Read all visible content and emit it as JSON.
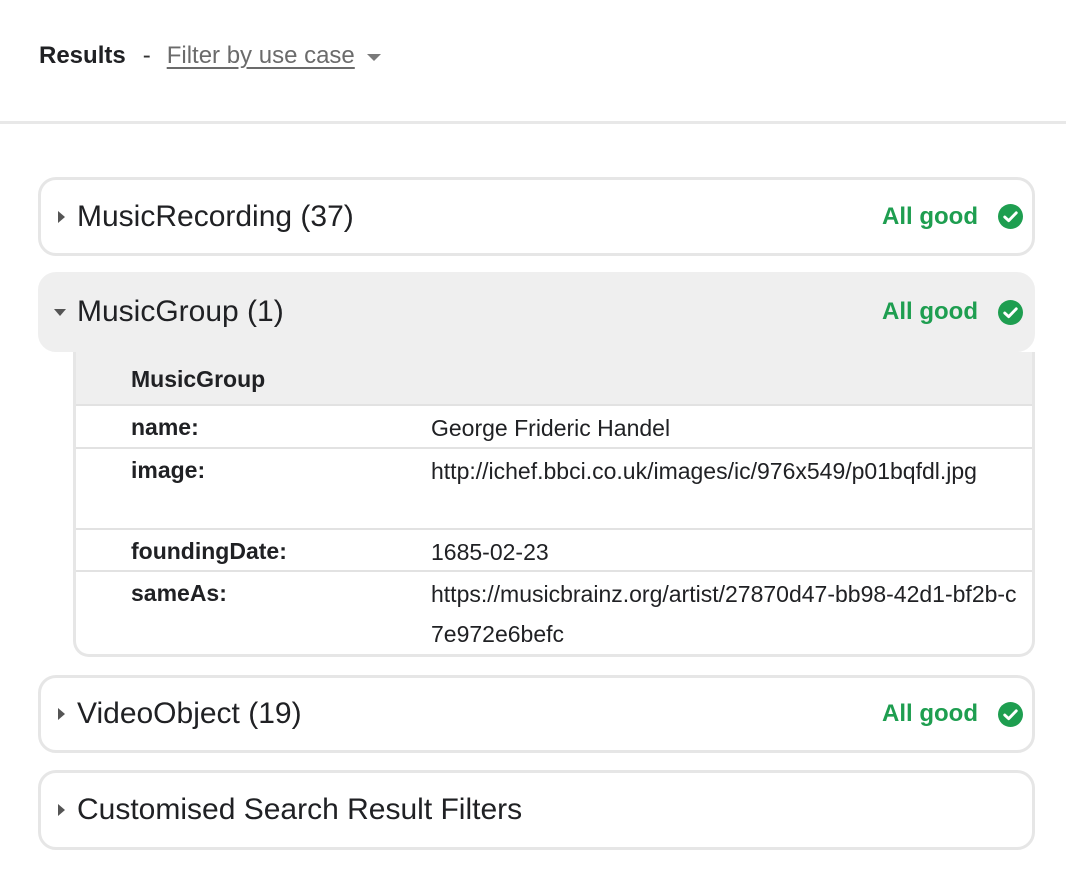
{
  "header": {
    "title": "Results",
    "separator": "-",
    "filter_label": "Filter by use case"
  },
  "status_color": "#1e9e50",
  "sections": [
    {
      "title": "MusicRecording (37)",
      "status": "All good",
      "icon": "check-circle-icon",
      "expanded": false
    },
    {
      "title": "MusicGroup (1)",
      "status": "All good",
      "icon": "check-circle-icon",
      "expanded": true
    },
    {
      "title": "VideoObject (19)",
      "status": "All good",
      "icon": "check-circle-icon",
      "expanded": false
    },
    {
      "title": "Customised Search Result Filters",
      "expanded": false
    }
  ],
  "details": {
    "title": "MusicGroup",
    "properties": [
      {
        "key": "name:",
        "value": "George Frideric Handel"
      },
      {
        "key": "image:",
        "value": "http://ichef.bbci.co.uk/images/ic/976x549/p01bqfdl.jpg"
      },
      {
        "key": "foundingDate:",
        "value": "1685-02-23"
      },
      {
        "key": "sameAs:",
        "value": "https://musicbrainz.org/artist/27870d47-bb98-42d1-bf2b-c7e972e6befc"
      }
    ]
  }
}
